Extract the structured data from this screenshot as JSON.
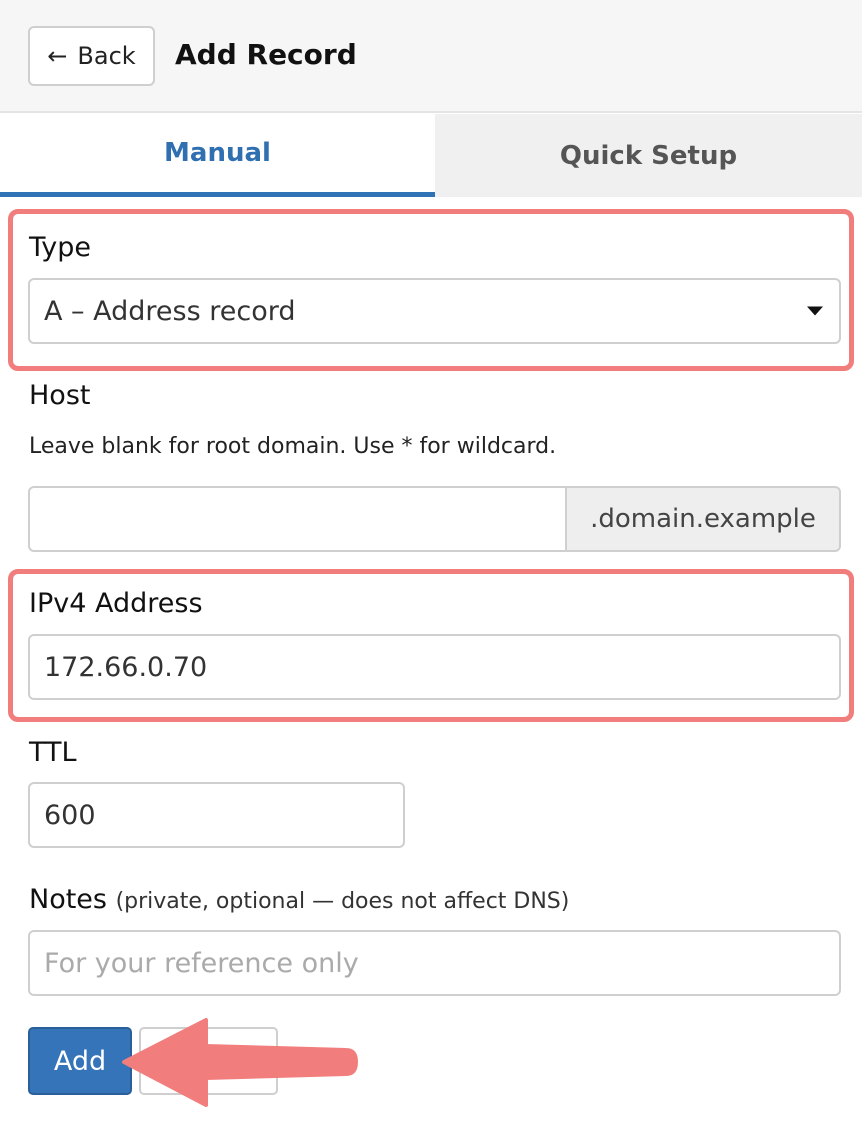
{
  "header": {
    "back_label": "Back",
    "title": "Add Record"
  },
  "tabs": [
    {
      "label": "Manual",
      "active": true
    },
    {
      "label": "Quick Setup",
      "active": false
    }
  ],
  "form": {
    "type": {
      "label": "Type",
      "value": "A – Address record"
    },
    "host": {
      "label": "Host",
      "help": "Leave blank for root domain. Use * for wildcard.",
      "value": "",
      "suffix": ".domain.example"
    },
    "ipv4": {
      "label": "IPv4 Address",
      "value": "172.66.0.70"
    },
    "ttl": {
      "label": "TTL",
      "value": "600"
    },
    "notes": {
      "label": "Notes",
      "hint": "(private, optional — does not affect DNS)",
      "placeholder": "For your reference only"
    }
  },
  "actions": {
    "add_label": "Add",
    "cancel_label": ""
  },
  "colors": {
    "accent": "#3574b8",
    "highlight": "#f27d7d"
  },
  "icons": {
    "back": "left-arrow-icon",
    "select": "caret-down-icon",
    "annotation": "pointer-arrow-icon"
  }
}
